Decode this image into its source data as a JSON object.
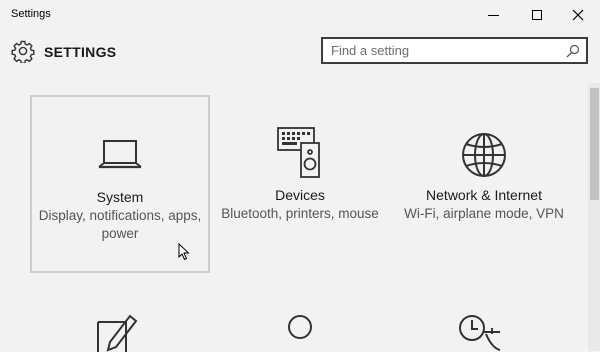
{
  "window": {
    "title": "Settings",
    "controls": [
      "minimize",
      "maximize",
      "close"
    ]
  },
  "header": {
    "title": "SETTINGS",
    "icon": "gear-icon"
  },
  "search": {
    "placeholder": "Find a setting",
    "value": "",
    "icon": "search-icon"
  },
  "categories": [
    {
      "name": "System",
      "description": "Display, notifications, apps, power",
      "icon": "laptop-icon",
      "selected": true
    },
    {
      "name": "Devices",
      "description": "Bluetooth, printers, mouse",
      "icon": "keyboard-speaker-icon",
      "selected": false
    },
    {
      "name": "Network & Internet",
      "description": "Wi-Fi, airplane mode, VPN",
      "icon": "globe-icon",
      "selected": false
    }
  ],
  "categories_partial": [
    {
      "icon": "pen-tablet-icon"
    },
    {
      "icon": "person-icon"
    },
    {
      "icon": "clock-language-icon"
    }
  ],
  "colors": {
    "background": "#f2f2f2",
    "icon_stroke": "#333333",
    "selected_border": "#cdcdcd"
  }
}
